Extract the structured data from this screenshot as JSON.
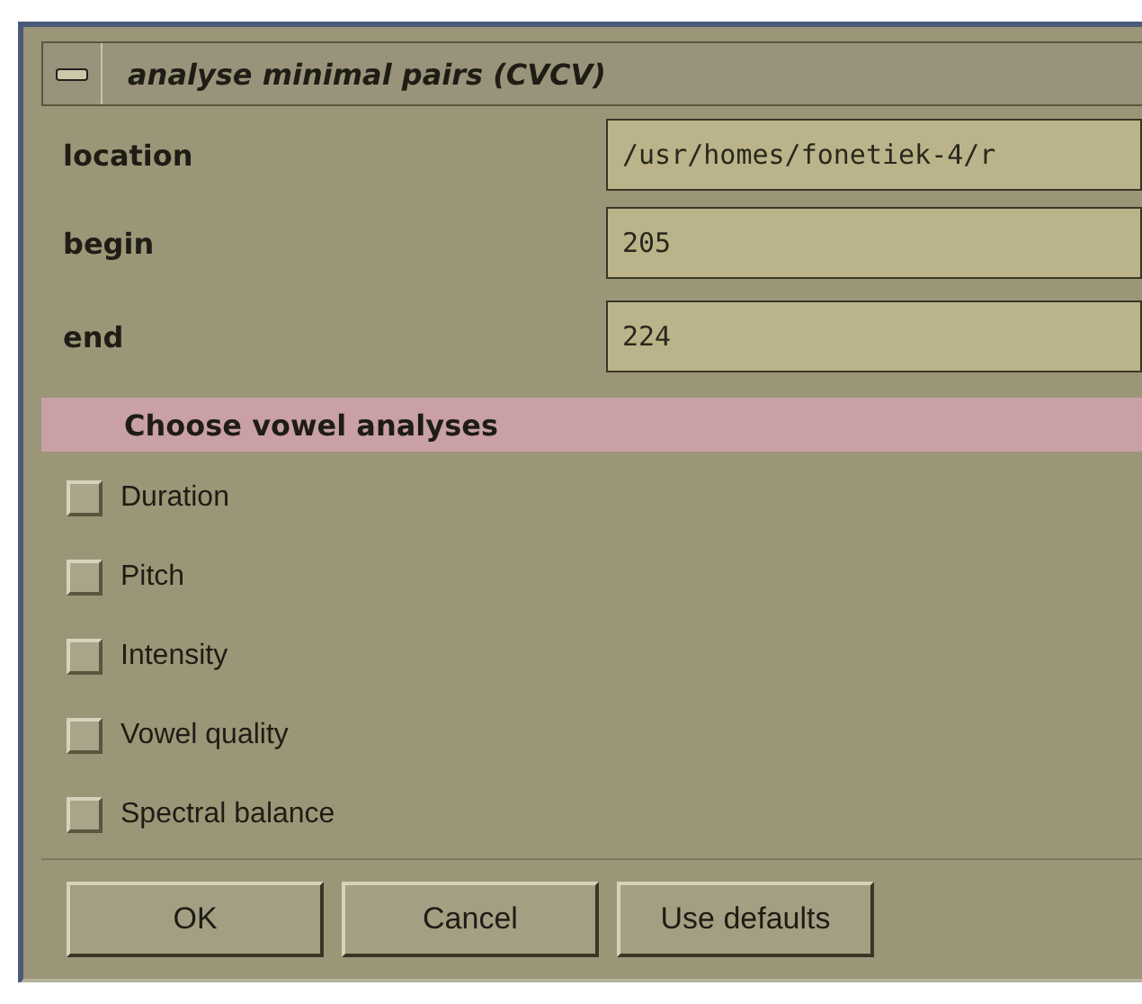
{
  "window": {
    "title": "analyse minimal pairs (CVCV)"
  },
  "fields": [
    {
      "label": "location",
      "value": "/usr/homes/fonetiek-4/r"
    },
    {
      "label": "begin",
      "value": "205"
    },
    {
      "label": "end",
      "value": "224"
    }
  ],
  "section": {
    "title": "Choose vowel analyses"
  },
  "options": [
    {
      "label": "Duration",
      "checked": false
    },
    {
      "label": "Pitch",
      "checked": false
    },
    {
      "label": "Intensity",
      "checked": false
    },
    {
      "label": "Vowel quality",
      "checked": false
    },
    {
      "label": "Spectral balance",
      "checked": false
    }
  ],
  "buttons": [
    "OK",
    "Cancel",
    "Use defaults"
  ]
}
